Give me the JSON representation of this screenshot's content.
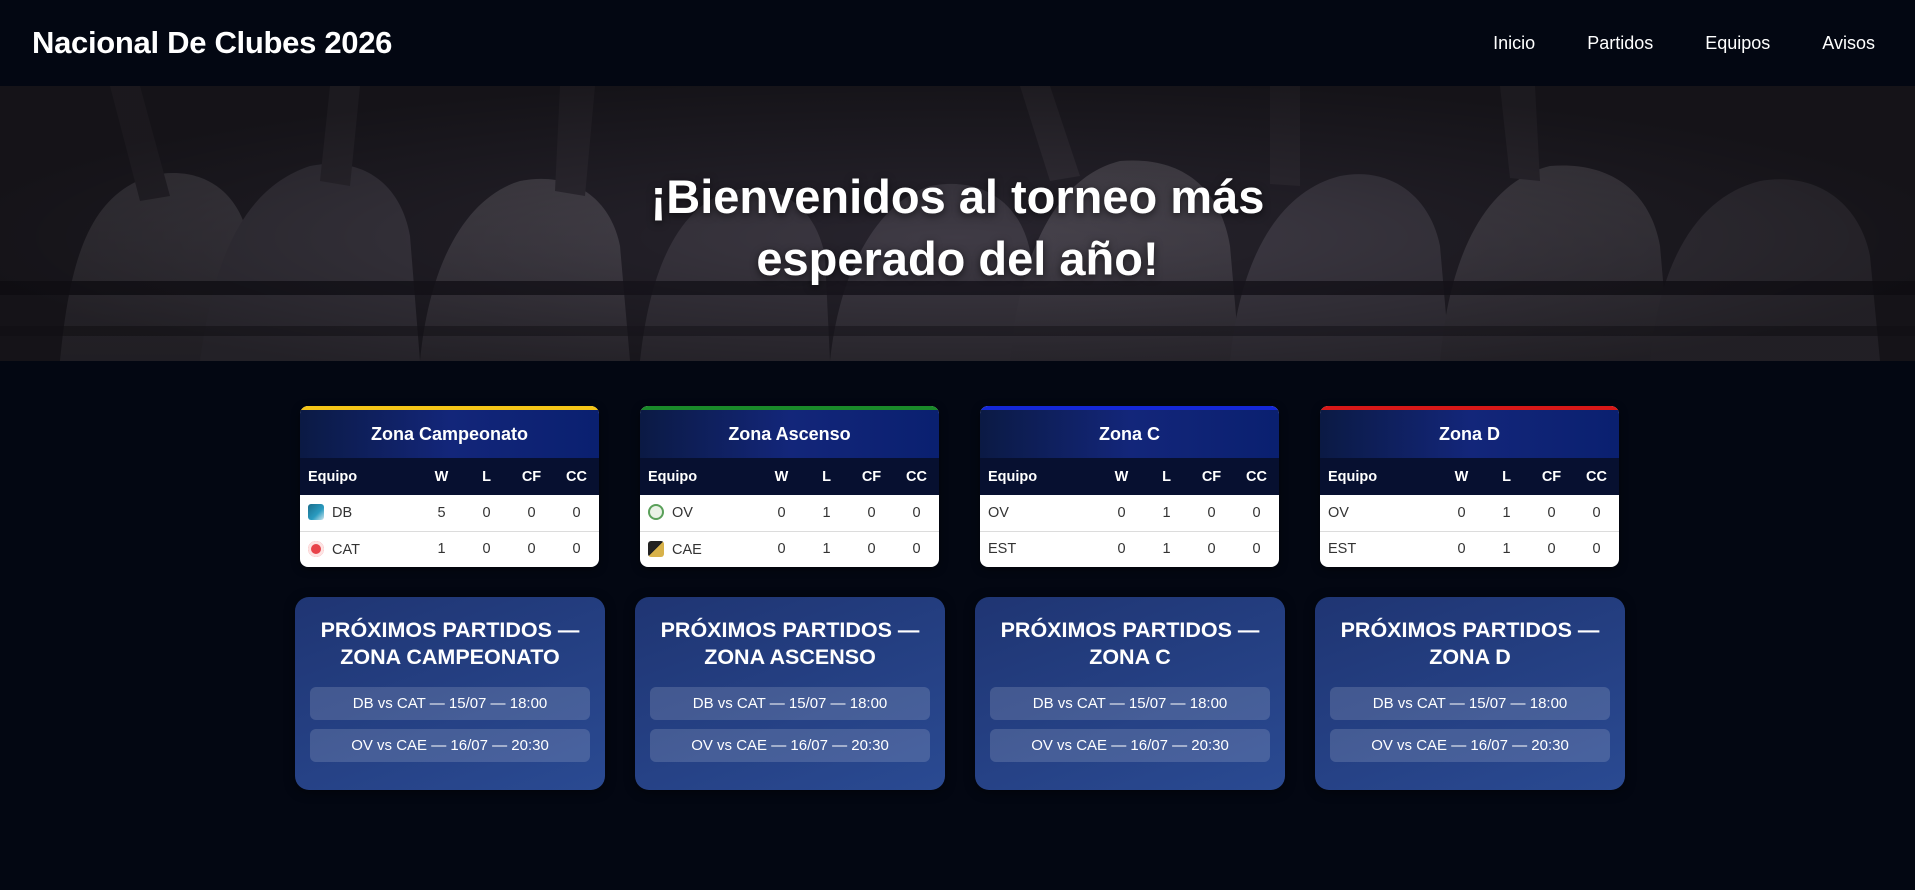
{
  "header": {
    "title": "Nacional De Clubes 2026",
    "nav": [
      "Inicio",
      "Partidos",
      "Equipos",
      "Avisos"
    ]
  },
  "hero": {
    "line1": "¡Bienvenidos al torneo más",
    "line2": "esperado del año!"
  },
  "colors": {
    "zone_accents": [
      "#f5c518",
      "#1a8a2a",
      "#1428d8",
      "#d81818"
    ]
  },
  "columns": [
    "Equipo",
    "W",
    "L",
    "CF",
    "CC"
  ],
  "zones": [
    {
      "name": "Zona Campeonato",
      "rows": [
        {
          "team": "DB",
          "icon": "db-logo-icon",
          "w": "5",
          "l": "0",
          "cf": "0",
          "cc": "0"
        },
        {
          "team": "CAT",
          "icon": "cat-logo-icon",
          "w": "1",
          "l": "0",
          "cf": "0",
          "cc": "0"
        }
      ],
      "next_title": "PRÓXIMOS PARTIDOS — ZONA CAMPEONATO",
      "matches": [
        "DB vs CAT — 15/07 — 18:00",
        "OV vs CAE — 16/07 — 20:30"
      ]
    },
    {
      "name": "Zona Ascenso",
      "rows": [
        {
          "team": "OV",
          "icon": "ov-logo-icon",
          "w": "0",
          "l": "1",
          "cf": "0",
          "cc": "0"
        },
        {
          "team": "CAE",
          "icon": "cae-logo-icon",
          "w": "0",
          "l": "1",
          "cf": "0",
          "cc": "0"
        }
      ],
      "next_title": "PRÓXIMOS PARTIDOS — ZONA ASCENSO",
      "matches": [
        "DB vs CAT — 15/07 — 18:00",
        "OV vs CAE — 16/07 — 20:30"
      ]
    },
    {
      "name": "Zona C",
      "rows": [
        {
          "team": "OV",
          "w": "0",
          "l": "1",
          "cf": "0",
          "cc": "0"
        },
        {
          "team": "EST",
          "w": "0",
          "l": "1",
          "cf": "0",
          "cc": "0"
        }
      ],
      "next_title": "PRÓXIMOS PARTIDOS — ZONA C",
      "matches": [
        "DB vs CAT — 15/07 — 18:00",
        "OV vs CAE — 16/07 — 20:30"
      ]
    },
    {
      "name": "Zona D",
      "rows": [
        {
          "team": "OV",
          "w": "0",
          "l": "1",
          "cf": "0",
          "cc": "0"
        },
        {
          "team": "EST",
          "w": "0",
          "l": "1",
          "cf": "0",
          "cc": "0"
        }
      ],
      "next_title": "PRÓXIMOS PARTIDOS — ZONA D",
      "matches": [
        "DB vs CAT — 15/07 — 18:00",
        "OV vs CAE — 16/07 — 20:30"
      ]
    }
  ]
}
